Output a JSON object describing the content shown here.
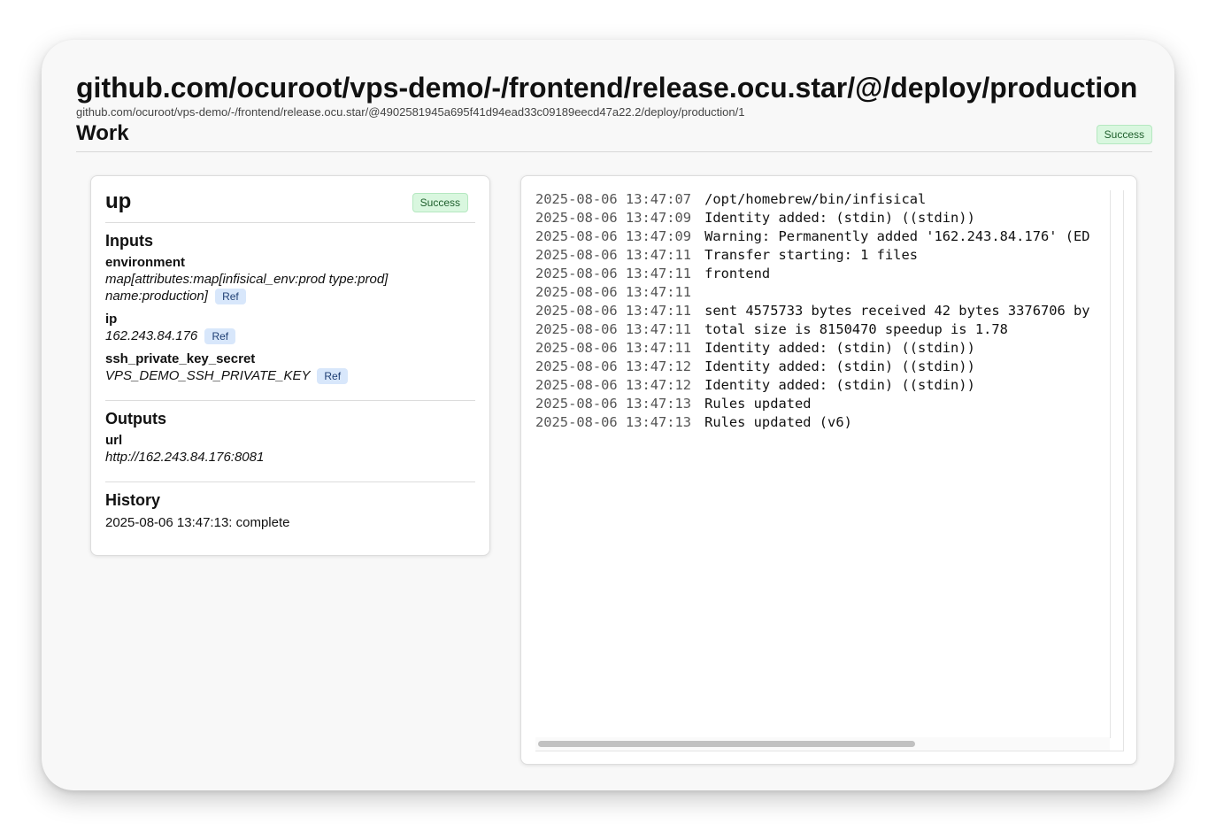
{
  "header": {
    "title": "github.com/ocuroot/vps-demo/-/frontend/release.ocu.star/@/deploy/production",
    "subtitle": "github.com/ocuroot/vps-demo/-/frontend/release.ocu.star/@4902581945a695f41d94ead33c09189eecd47a22.2/deploy/production/1",
    "section_title": "Work",
    "status": "Success"
  },
  "work_card": {
    "title": "up",
    "status": "Success",
    "inputs": {
      "title": "Inputs",
      "items": [
        {
          "name": "environment",
          "value": "map[attributes:map[infisical_env:prod type:prod] name:production]",
          "ref_label": "Ref"
        },
        {
          "name": "ip",
          "value": "162.243.84.176",
          "ref_label": "Ref"
        },
        {
          "name": "ssh_private_key_secret",
          "value": "VPS_DEMO_SSH_PRIVATE_KEY",
          "ref_label": "Ref"
        }
      ]
    },
    "outputs": {
      "title": "Outputs",
      "items": [
        {
          "name": "url",
          "value": "http://162.243.84.176:8081"
        }
      ]
    },
    "history": {
      "title": "History",
      "items": [
        "2025-08-06 13:47:13: complete"
      ]
    }
  },
  "log": {
    "lines": [
      {
        "ts": "2025-08-06 13:47:07",
        "msg": "/opt/homebrew/bin/infisical"
      },
      {
        "ts": "2025-08-06 13:47:09",
        "msg": "Identity added: (stdin) ((stdin))"
      },
      {
        "ts": "2025-08-06 13:47:09",
        "msg": "Warning: Permanently added '162.243.84.176' (ED"
      },
      {
        "ts": "2025-08-06 13:47:11",
        "msg": "Transfer starting: 1 files"
      },
      {
        "ts": "2025-08-06 13:47:11",
        "msg": "frontend"
      },
      {
        "ts": "2025-08-06 13:47:11",
        "msg": ""
      },
      {
        "ts": "2025-08-06 13:47:11",
        "msg": "sent 4575733 bytes received 42 bytes 3376706 by"
      },
      {
        "ts": "2025-08-06 13:47:11",
        "msg": "total size is 8150470 speedup is 1.78"
      },
      {
        "ts": "2025-08-06 13:47:11",
        "msg": "Identity added: (stdin) ((stdin))"
      },
      {
        "ts": "2025-08-06 13:47:12",
        "msg": "Identity added: (stdin) ((stdin))"
      },
      {
        "ts": "2025-08-06 13:47:12",
        "msg": "Identity added: (stdin) ((stdin))"
      },
      {
        "ts": "2025-08-06 13:47:13",
        "msg": "Rules updated"
      },
      {
        "ts": "2025-08-06 13:47:13",
        "msg": "Rules updated (v6)"
      }
    ]
  },
  "colors": {
    "success_bg": "#d9f7df",
    "success_text": "#1d5e2b",
    "ref_bg": "#d8e7fb",
    "ref_text": "#1f3f74"
  }
}
